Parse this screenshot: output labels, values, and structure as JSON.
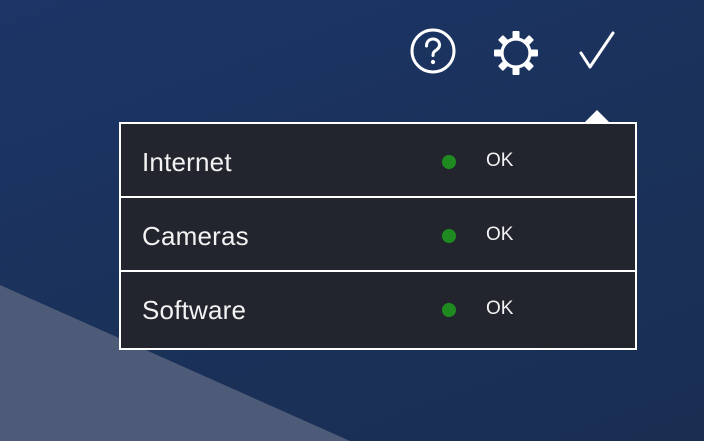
{
  "toolbar": {
    "help_icon": "question-circle-icon",
    "settings_icon": "gear-icon",
    "status_icon": "checkmark-icon"
  },
  "status_panel": {
    "rows": [
      {
        "label": "Internet",
        "status": "OK",
        "status_color": "#1f8a1f"
      },
      {
        "label": "Cameras",
        "status": "OK",
        "status_color": "#1f8a1f"
      },
      {
        "label": "Software",
        "status": "OK",
        "status_color": "#1f8a1f"
      }
    ]
  },
  "colors": {
    "background": "#1b3160",
    "panel": "#22252d",
    "panel_border": "#ffffff",
    "text": "#f2f2f2",
    "ok": "#1f8a1f"
  }
}
